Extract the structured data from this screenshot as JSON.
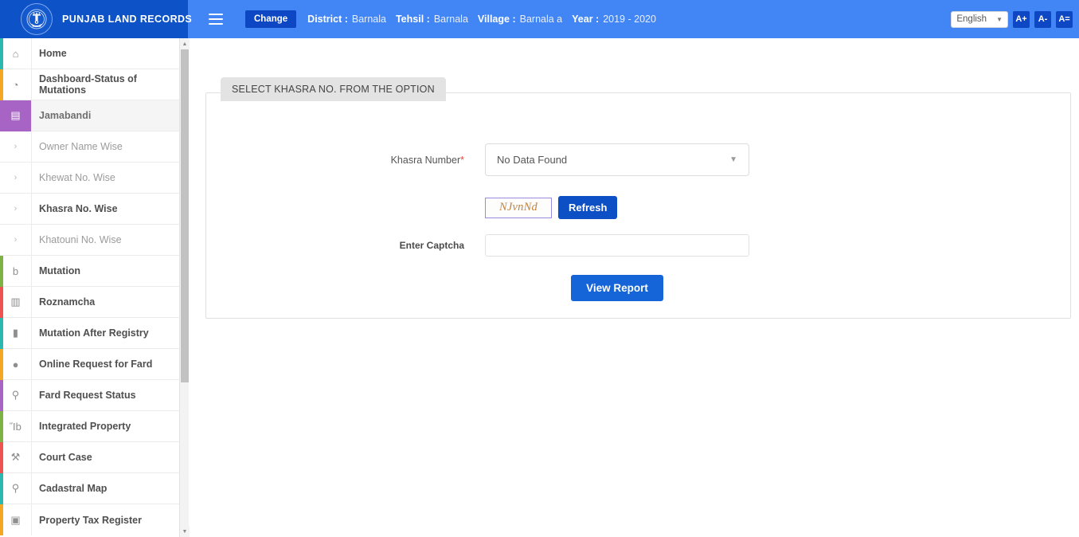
{
  "header": {
    "brand": "PUNJAB LAND RECORDS",
    "emblem_icon": "national-emblem-icon",
    "menu_icon": "hamburger-menu-icon",
    "change_label": "Change",
    "breadcrumb": [
      {
        "key": "District :",
        "value": "Barnala"
      },
      {
        "key": "Tehsil :",
        "value": "Barnala"
      },
      {
        "key": "Village :",
        "value": "Barnala a"
      },
      {
        "key": "Year :",
        "value": "2019 - 2020"
      }
    ],
    "language": "English",
    "font_increase": "A+",
    "font_decrease": "A-",
    "font_reset": "A=",
    "bg_color": "#4285f4",
    "brand_bg_color": "#0d52c7"
  },
  "sidebar": {
    "items": [
      {
        "label": "Home",
        "icon": "home-icon",
        "glyph": "⌂",
        "accent": "#2bb8b0",
        "type": "item",
        "expandable": false
      },
      {
        "label": "Dashboard-Status of Mutations",
        "icon": "dashboard-icon",
        "glyph": "◔",
        "accent": "#f5a623",
        "type": "item",
        "expandable": false
      },
      {
        "label": "Jamabandi",
        "icon": "records-book-icon",
        "glyph": "▤",
        "accent": "#a764c4",
        "type": "item",
        "expandable": true,
        "active": true
      },
      {
        "label": "Owner Name Wise",
        "icon": "chevron-right-icon",
        "glyph": "›",
        "type": "sub",
        "expandable": false
      },
      {
        "label": "Khewat No. Wise",
        "icon": "chevron-right-icon",
        "glyph": "›",
        "type": "sub",
        "expandable": false
      },
      {
        "label": "Khasra No. Wise",
        "icon": "chevron-right-icon",
        "glyph": "›",
        "type": "sub",
        "expandable": false,
        "selected": true
      },
      {
        "label": "Khatouni No. Wise",
        "icon": "chevron-right-icon",
        "glyph": "›",
        "type": "sub",
        "expandable": false
      },
      {
        "label": "Mutation",
        "icon": "document-icon",
        "glyph": "὜b",
        "accent": "#7cb342",
        "type": "item",
        "expandable": true
      },
      {
        "label": "Roznamcha",
        "icon": "book-icon",
        "glyph": "▥",
        "accent": "#ef5350",
        "type": "item",
        "expandable": true
      },
      {
        "label": "Mutation After Registry",
        "icon": "briefcase-icon",
        "glyph": "▮",
        "accent": "#2bb8b0",
        "type": "item",
        "expandable": false
      },
      {
        "label": "Online Request for Fard",
        "icon": "droplet-icon",
        "glyph": "●",
        "accent": "#f5a623",
        "type": "item",
        "expandable": true
      },
      {
        "label": "Fard Request Status",
        "icon": "search-icon",
        "glyph": "⚲",
        "accent": "#a764c4",
        "type": "item",
        "expandable": false
      },
      {
        "label": "Integrated Property",
        "icon": "bank-icon",
        "glyph": "Ἵb",
        "accent": "#7cb342",
        "type": "item",
        "expandable": false
      },
      {
        "label": "Court Case",
        "icon": "gavel-icon",
        "glyph": "⚒",
        "accent": "#ef5350",
        "type": "item",
        "expandable": false
      },
      {
        "label": "Cadastral Map",
        "icon": "map-pin-icon",
        "glyph": "⚲",
        "accent": "#2bb8b0",
        "type": "item",
        "expandable": false
      },
      {
        "label": "Property Tax Register",
        "icon": "register-icon",
        "glyph": "▣",
        "accent": "#f5a623",
        "type": "cut",
        "expandable": false
      }
    ]
  },
  "form": {
    "legend": "SELECT KHASRA NO. FROM THE OPTION",
    "khasra_label": "Khasra Number",
    "khasra_required_mark": "*",
    "khasra_value": "No Data Found",
    "captcha_text": "NJvnNd",
    "refresh_label": "Refresh",
    "captcha_label": "Enter Captcha",
    "captcha_input_value": "",
    "captcha_placeholder": "",
    "view_report_label": "View Report"
  }
}
